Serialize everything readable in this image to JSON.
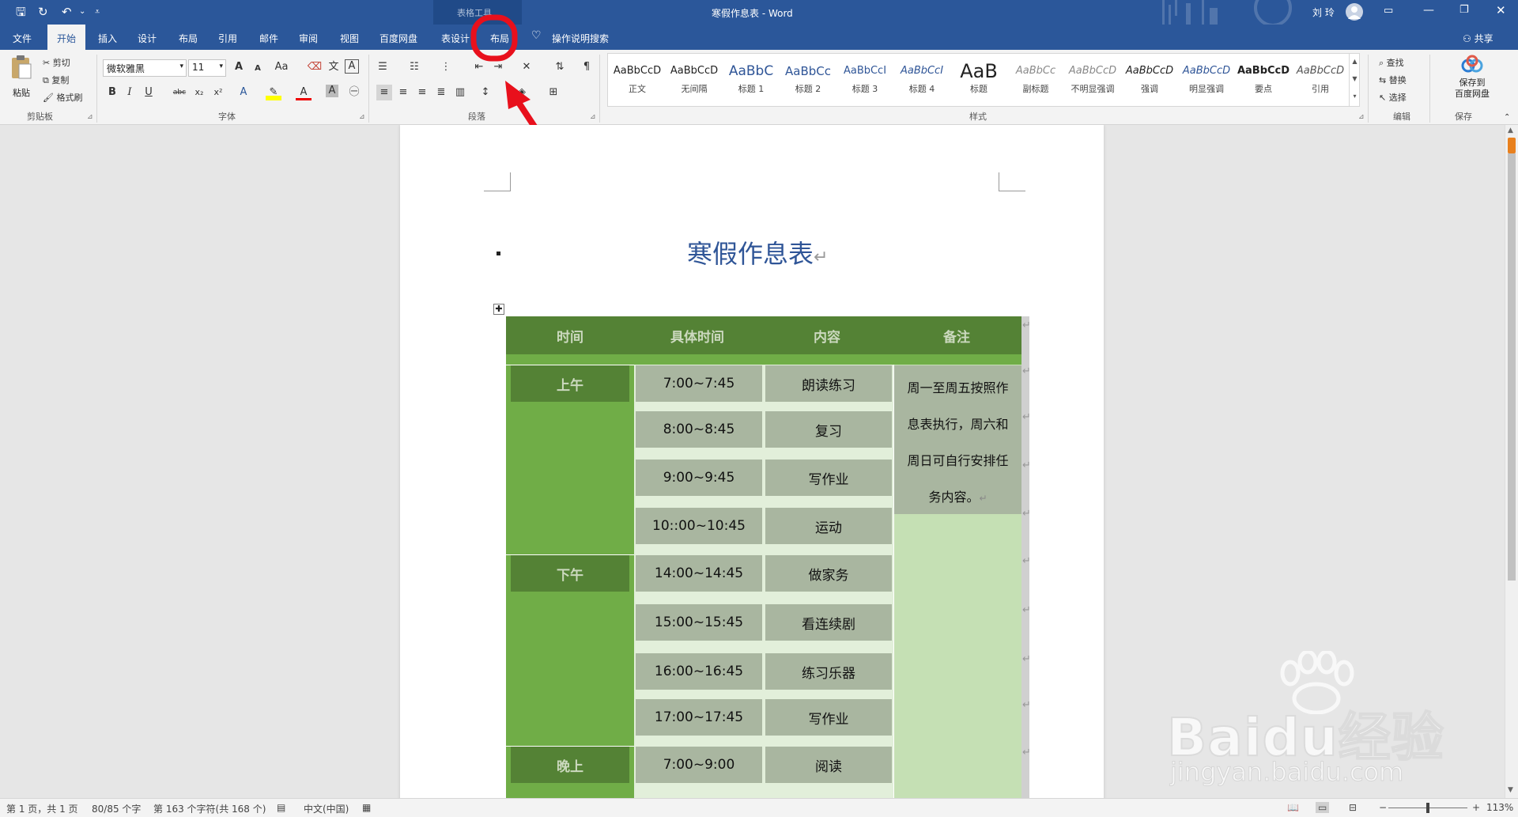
{
  "window": {
    "title": "寒假作息表 - Word",
    "tool_context": "表格工具",
    "user": "刘 玲"
  },
  "tabs": [
    "文件",
    "开始",
    "插入",
    "设计",
    "布局",
    "引用",
    "邮件",
    "审阅",
    "视图",
    "百度网盘",
    "表设计",
    "布局"
  ],
  "tell_me": "操作说明搜索",
  "share": "共享",
  "clipboard": {
    "paste": "粘贴",
    "cut": "剪切",
    "copy": "复制",
    "format_painter": "格式刷",
    "group": "剪贴板"
  },
  "font": {
    "name": "微软雅黑",
    "size": "11",
    "group": "字体",
    "grow": "A",
    "shrink": "A",
    "case": "Aa",
    "bold": "B",
    "italic": "I",
    "underline": "U",
    "strike": "abc",
    "sub": "x₂",
    "sup": "x²"
  },
  "paragraph": {
    "group": "段落"
  },
  "styles": {
    "group": "样式",
    "items": [
      {
        "preview": "AaBbCcD",
        "name": "正文"
      },
      {
        "preview": "AaBbCcD",
        "name": "无间隔"
      },
      {
        "preview": "AaBbC",
        "name": "标题 1"
      },
      {
        "preview": "AaBbCc",
        "name": "标题 2"
      },
      {
        "preview": "AaBbCcI",
        "name": "标题 3"
      },
      {
        "preview": "AaBbCcI",
        "name": "标题 4"
      },
      {
        "preview": "AaB",
        "name": "标题"
      },
      {
        "preview": "AaBbCc",
        "name": "副标题"
      },
      {
        "preview": "AaBbCcD",
        "name": "不明显强调"
      },
      {
        "preview": "AaBbCcD",
        "name": "强调"
      },
      {
        "preview": "AaBbCcD",
        "name": "明显强调"
      },
      {
        "preview": "AaBbCcD",
        "name": "要点"
      },
      {
        "preview": "AaBbCcD",
        "name": "引用"
      }
    ]
  },
  "editing": {
    "find": "查找",
    "replace": "替换",
    "select": "选择",
    "group": "编辑"
  },
  "save": {
    "line1": "保存到",
    "line2": "百度网盘",
    "group": "保存"
  },
  "document": {
    "heading": "寒假作息表",
    "table": {
      "headers": [
        "时间",
        "具体时间",
        "内容",
        "备注"
      ],
      "periods": [
        "上午",
        "下午",
        "晚上"
      ],
      "rows": [
        {
          "time": "7:00~7:45",
          "content": "朗读练习"
        },
        {
          "time": "8:00~8:45",
          "content": "复习"
        },
        {
          "time": "9:00~9:45",
          "content": "写作业"
        },
        {
          "time": "10::00~10:45",
          "content": "运动"
        },
        {
          "time": "14:00~14:45",
          "content": "做家务"
        },
        {
          "time": "15:00~15:45",
          "content": "看连续剧"
        },
        {
          "time": "16:00~16:45",
          "content": "练习乐器"
        },
        {
          "time": "17:00~17:45",
          "content": "写作业"
        },
        {
          "time": "7:00~9:00",
          "content": "阅读"
        }
      ],
      "note_lines": [
        "周一至周五按照作",
        "息表执行，周六和",
        "周日可自行安排任",
        "务内容。"
      ]
    }
  },
  "status": {
    "page": "第 1 页，共 1 页",
    "words": "80/85 个字",
    "chars": "第 163 个字符(共 168 个)",
    "lang": "中文(中国)",
    "zoom": "113%"
  },
  "watermark": {
    "brand": "Baidu经验",
    "url": "jingyan.baidu.com"
  },
  "colors": {
    "accent": "#2b579a",
    "annotation": "#e8101c",
    "table_header": "#548235",
    "table_dark": "#70ad47",
    "table_light": "#c5e0b4",
    "cell_gray": "#a9b6a0"
  }
}
